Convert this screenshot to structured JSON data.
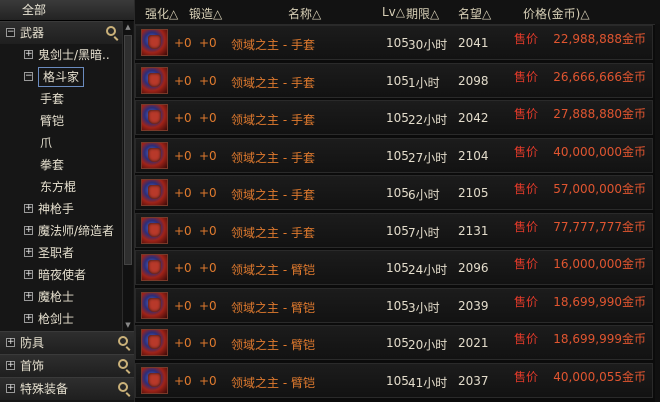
{
  "sidebar": {
    "header": "全部",
    "tree": [
      {
        "label": "武器",
        "box": "⊟",
        "level": 0,
        "search": true,
        "cat": true
      },
      {
        "label": "鬼剑士/黑暗..",
        "box": "⊞",
        "level": 1
      },
      {
        "label": "格斗家",
        "box": "⊟",
        "level": 1,
        "selected": true
      },
      {
        "label": "手套",
        "level": 2
      },
      {
        "label": "臂铠",
        "level": 2
      },
      {
        "label": "爪",
        "level": 2
      },
      {
        "label": "拳套",
        "level": 2
      },
      {
        "label": "东方棍",
        "level": 2
      },
      {
        "label": "神枪手",
        "box": "⊞",
        "level": 1
      },
      {
        "label": "魔法师/缔造者",
        "box": "⊞",
        "level": 1
      },
      {
        "label": "圣职者",
        "box": "⊞",
        "level": 1
      },
      {
        "label": "暗夜使者",
        "box": "⊞",
        "level": 1
      },
      {
        "label": "魔枪士",
        "box": "⊞",
        "level": 1
      },
      {
        "label": "枪剑士",
        "box": "⊞",
        "level": 1
      }
    ],
    "bottom": [
      {
        "label": "防具",
        "box": "⊞"
      },
      {
        "label": "首饰",
        "box": "⊞"
      },
      {
        "label": "特殊装备",
        "box": "⊞"
      }
    ]
  },
  "columns": {
    "enhance": "强化△",
    "forge": "锻造△",
    "name": "名称△",
    "lv": "Lv△",
    "period": "期限△",
    "fame": "名望△",
    "price": "价格(金币)△"
  },
  "rows": [
    {
      "enhance": "+0",
      "forge": "+0",
      "name": "领域之主 - 手套",
      "lv": "105",
      "period": "30小时",
      "fame": "2041",
      "sell": "售价",
      "price": "22,988,888金币"
    },
    {
      "enhance": "+0",
      "forge": "+0",
      "name": "领域之主 - 手套",
      "lv": "105",
      "period": "1小时",
      "fame": "2098",
      "sell": "售价",
      "price": "26,666,666金币"
    },
    {
      "enhance": "+0",
      "forge": "+0",
      "name": "领域之主 - 手套",
      "lv": "105",
      "period": "22小时",
      "fame": "2042",
      "sell": "售价",
      "price": "27,888,880金币"
    },
    {
      "enhance": "+0",
      "forge": "+0",
      "name": "领域之主 - 手套",
      "lv": "105",
      "period": "27小时",
      "fame": "2104",
      "sell": "售价",
      "price": "40,000,000金币"
    },
    {
      "enhance": "+0",
      "forge": "+0",
      "name": "领域之主 - 手套",
      "lv": "105",
      "period": "6小时",
      "fame": "2105",
      "sell": "售价",
      "price": "57,000,000金币"
    },
    {
      "enhance": "+0",
      "forge": "+0",
      "name": "领域之主 - 手套",
      "lv": "105",
      "period": "7小时",
      "fame": "2131",
      "sell": "售价",
      "price": "77,777,777金币"
    },
    {
      "enhance": "+0",
      "forge": "+0",
      "name": "领域之主 - 臂铠",
      "lv": "105",
      "period": "24小时",
      "fame": "2096",
      "sell": "售价",
      "price": "16,000,000金币"
    },
    {
      "enhance": "+0",
      "forge": "+0",
      "name": "领域之主 - 臂铠",
      "lv": "105",
      "period": "3小时",
      "fame": "2039",
      "sell": "售价",
      "price": "18,699,990金币"
    },
    {
      "enhance": "+0",
      "forge": "+0",
      "name": "领域之主 - 臂铠",
      "lv": "105",
      "period": "20小时",
      "fame": "2021",
      "sell": "售价",
      "price": "18,699,999金币"
    },
    {
      "enhance": "+0",
      "forge": "+0",
      "name": "领域之主 - 臂铠",
      "lv": "105",
      "period": "41小时",
      "fame": "2037",
      "sell": "售价",
      "price": "40,000,055金币"
    }
  ],
  "icons": {
    "item": "gauntlet-icon",
    "search": "search-plus-icon"
  },
  "colors": {
    "name": "#e07a2e",
    "sell": "#e23a2a",
    "price": "#e05530",
    "background": "#0b0b0b"
  }
}
